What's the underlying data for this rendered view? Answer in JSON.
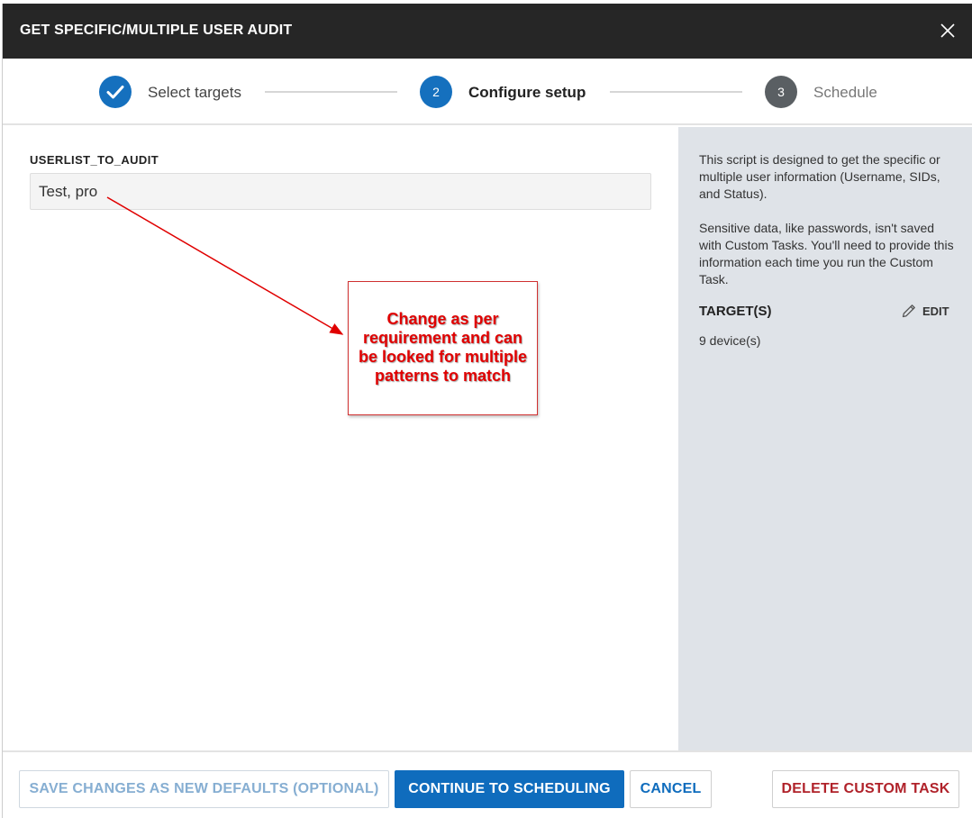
{
  "dialog": {
    "title": "GET SPECIFIC/MULTIPLE USER AUDIT",
    "close_icon": "close-icon"
  },
  "stepper": {
    "steps": [
      {
        "number": "",
        "label": "Select targets",
        "state": "completed",
        "icon": "checkmark-icon",
        "color": "#1570be"
      },
      {
        "number": "2",
        "label": "Configure setup",
        "state": "active",
        "color": "#1570be"
      },
      {
        "number": "3",
        "label": "Schedule",
        "state": "pending",
        "color": "#5a5f63"
      }
    ]
  },
  "form": {
    "field_label": "USERLIST_TO_AUDIT",
    "field_value": "Test, pro"
  },
  "annotation": {
    "text": "Change as per requirement and can be looked for multiple patterns to match",
    "color": "#e00000"
  },
  "side_panel": {
    "description_1": "This script is designed to get the specific or multiple user information (Username, SIDs, and Status).",
    "description_2": "Sensitive data, like passwords, isn't saved with Custom Tasks. You'll need to provide this information each time you run the Custom Task.",
    "targets_title": "TARGET(S)",
    "edit_label": "EDIT",
    "edit_icon": "pencil-icon",
    "targets_count": "9 device(s)"
  },
  "footer": {
    "save_defaults_label": "SAVE CHANGES AS NEW DEFAULTS (OPTIONAL)",
    "continue_label": "CONTINUE TO SCHEDULING",
    "cancel_label": "CANCEL",
    "delete_label": "DELETE CUSTOM TASK"
  },
  "colors": {
    "header_bg": "#262626",
    "primary": "#0f6cbd",
    "side_bg": "#dfe3e8",
    "danger": "#b0222a"
  }
}
